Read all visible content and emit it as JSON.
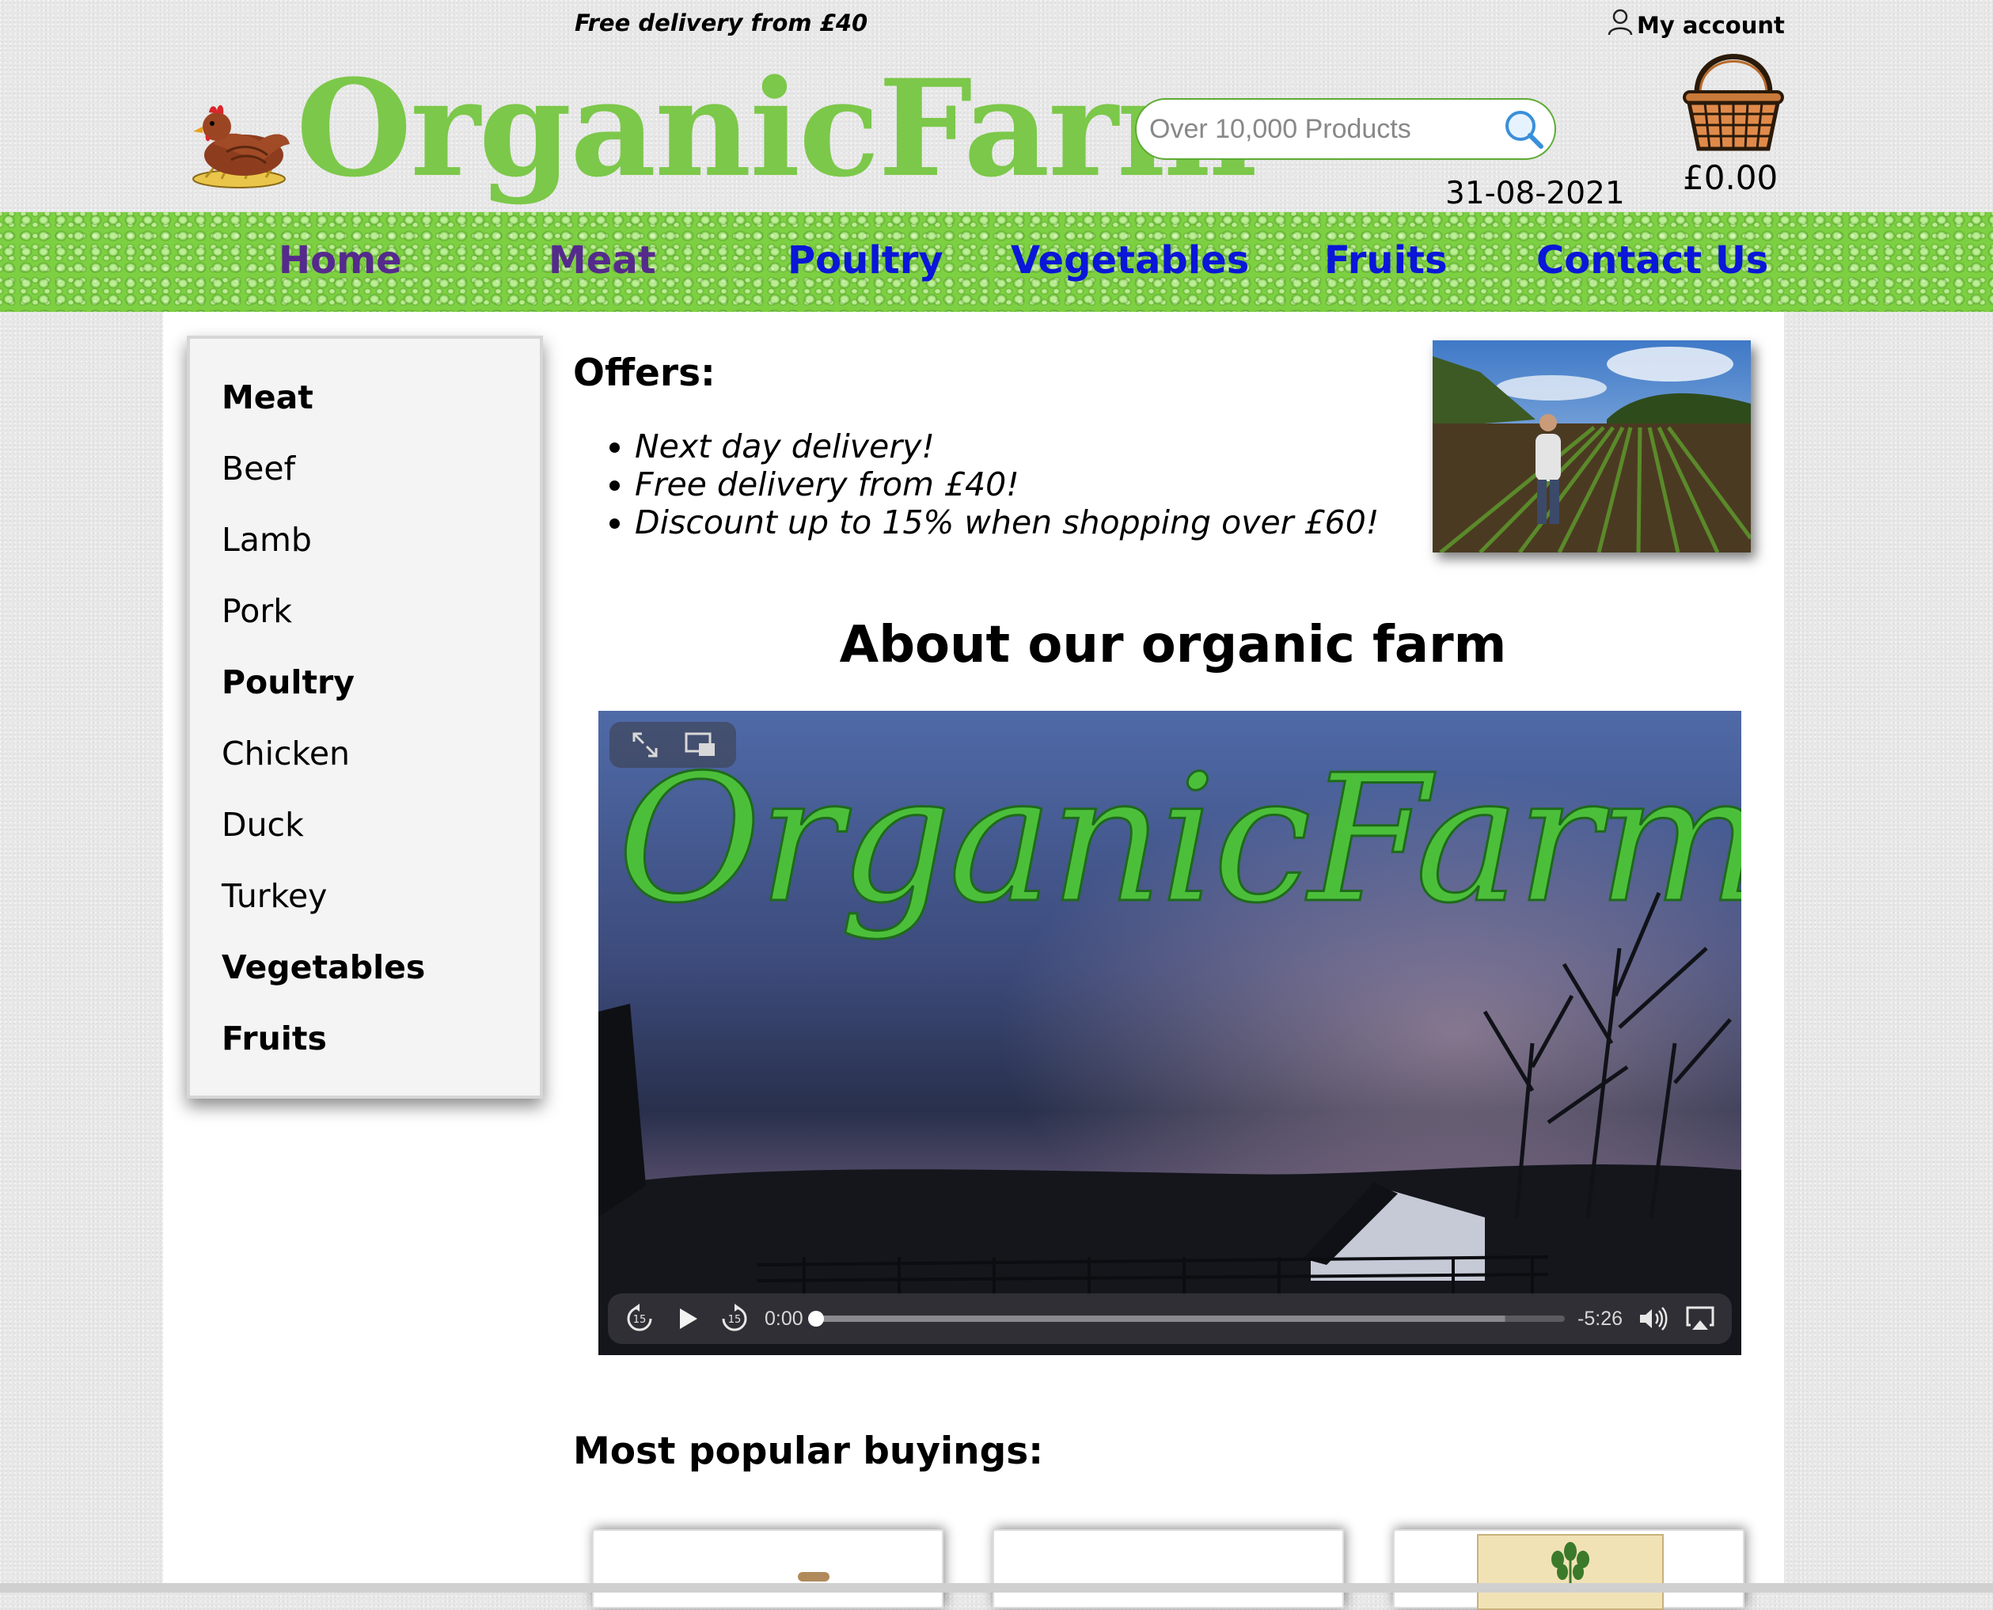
{
  "header": {
    "promo": "Free delivery from £40",
    "account_label": "My account",
    "logo_text": "OrganicFarm",
    "search_placeholder": "Over 10,000 Products",
    "date": "31-08-2021",
    "cart_total": "£0.00"
  },
  "nav": {
    "items": [
      {
        "label": "Home",
        "state": "visited"
      },
      {
        "label": "Meat",
        "state": "visited"
      },
      {
        "label": "Poultry",
        "state": "unvisited"
      },
      {
        "label": "Vegetables",
        "state": "unvisited"
      },
      {
        "label": "Fruits",
        "state": "unvisited"
      },
      {
        "label": "Contact Us",
        "state": "unvisited"
      }
    ]
  },
  "sidebar": {
    "items": [
      {
        "label": "Meat",
        "type": "category"
      },
      {
        "label": "Beef",
        "type": "item"
      },
      {
        "label": "Lamb",
        "type": "item"
      },
      {
        "label": "Pork",
        "type": "item"
      },
      {
        "label": "Poultry",
        "type": "category"
      },
      {
        "label": "Chicken",
        "type": "item"
      },
      {
        "label": "Duck",
        "type": "item"
      },
      {
        "label": "Turkey",
        "type": "item"
      },
      {
        "label": "Vegetables",
        "type": "category"
      },
      {
        "label": "Fruits",
        "type": "category"
      }
    ]
  },
  "offers": {
    "title": "Offers:",
    "items": [
      "Next day delivery!",
      "Free delivery from £40!",
      "Discount up to 15% when shopping over £60!"
    ]
  },
  "about": {
    "title": "About our organic farm"
  },
  "video": {
    "overlay_text": "OrganicFarm",
    "current_time": "0:00",
    "remaining_time": "-5:26",
    "progress": 0,
    "buffered": 0.92,
    "icons": [
      "fullscreen-icon",
      "picture-in-picture-icon",
      "skip-back-15-icon",
      "play-icon",
      "skip-forward-15-icon",
      "volume-icon",
      "airplay-icon"
    ]
  },
  "popular": {
    "title": "Most popular buyings:"
  },
  "colors": {
    "brand_green": "#7cc84a",
    "nav_visited": "#552a8c",
    "nav_unvisited": "#0a16d8"
  }
}
